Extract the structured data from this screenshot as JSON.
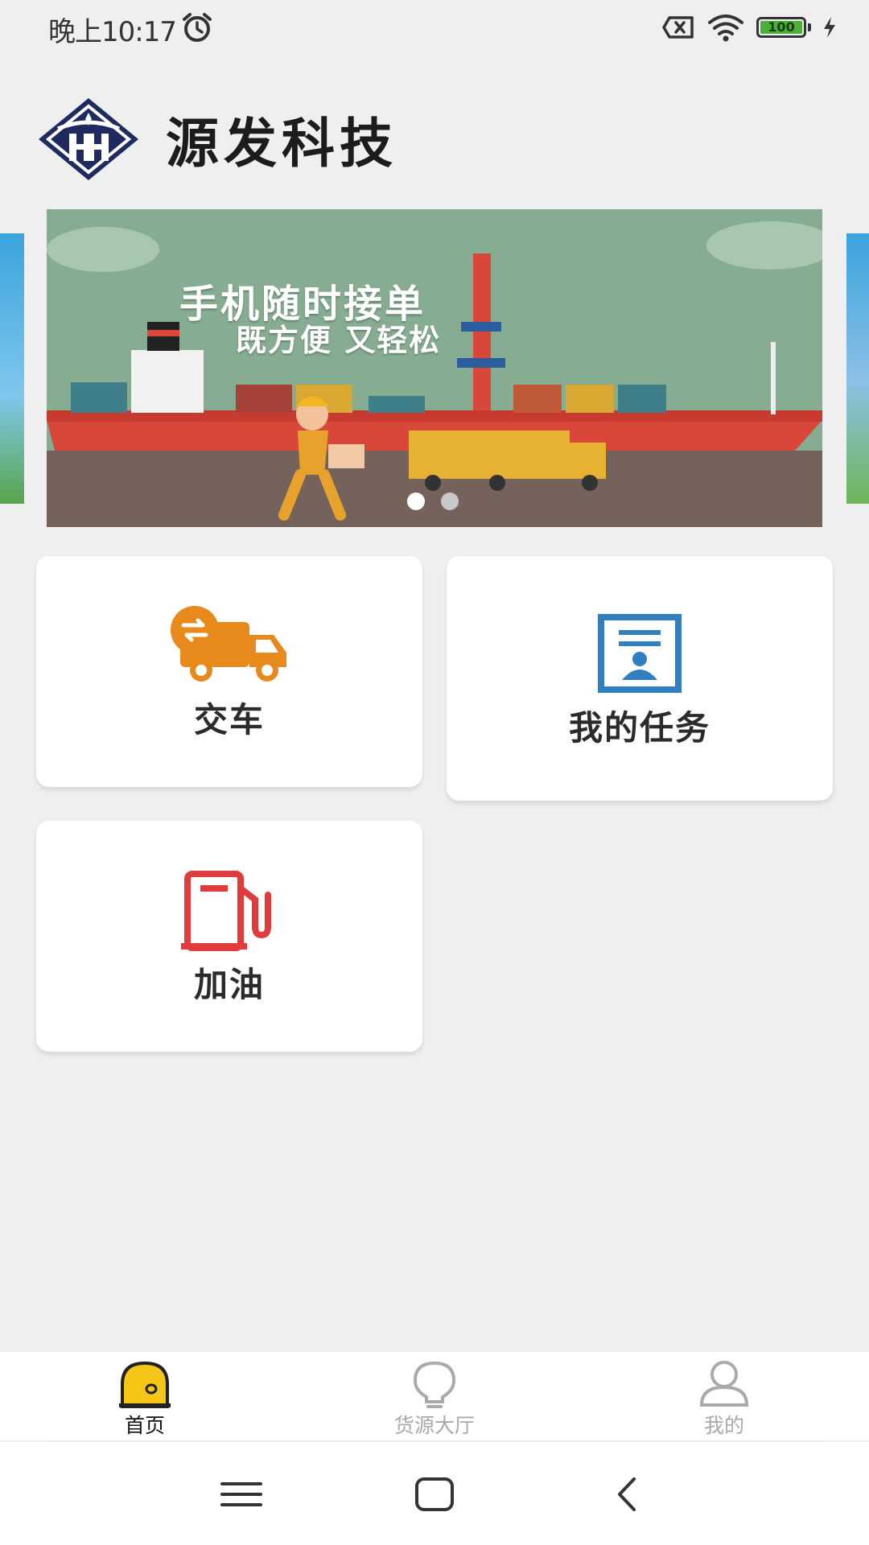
{
  "status_bar": {
    "time": "晚上10:17",
    "battery_level": "100",
    "icons": [
      "alarm-icon",
      "sim-none-icon",
      "wifi-icon",
      "battery-icon",
      "charging-icon"
    ]
  },
  "header": {
    "logo_icon": "company-logo-icon",
    "brand_name": "源发科技"
  },
  "banner": {
    "title": "手机随时接单",
    "subtitle": "既方便 又轻松",
    "slide_count": 2,
    "active_slide": 1
  },
  "cards": [
    {
      "label": "交车",
      "icon": "truck-exchange-icon",
      "color": "#e8891b"
    },
    {
      "label": "我的任务",
      "icon": "task-document-icon",
      "color": "#2f7fc1"
    },
    {
      "label": "加油",
      "icon": "fuel-pump-icon",
      "color": "#e03c3c"
    }
  ],
  "bottom_nav": {
    "items": [
      {
        "label": "首页",
        "icon": "home-icon",
        "active": true
      },
      {
        "label": "货源大厅",
        "icon": "lightbulb-icon",
        "active": false
      },
      {
        "label": "我的",
        "icon": "user-icon",
        "active": false
      }
    ],
    "active_color": "#f5c518"
  },
  "system_nav": {
    "icons": [
      "menu-icon",
      "home-square-icon",
      "back-icon"
    ]
  }
}
